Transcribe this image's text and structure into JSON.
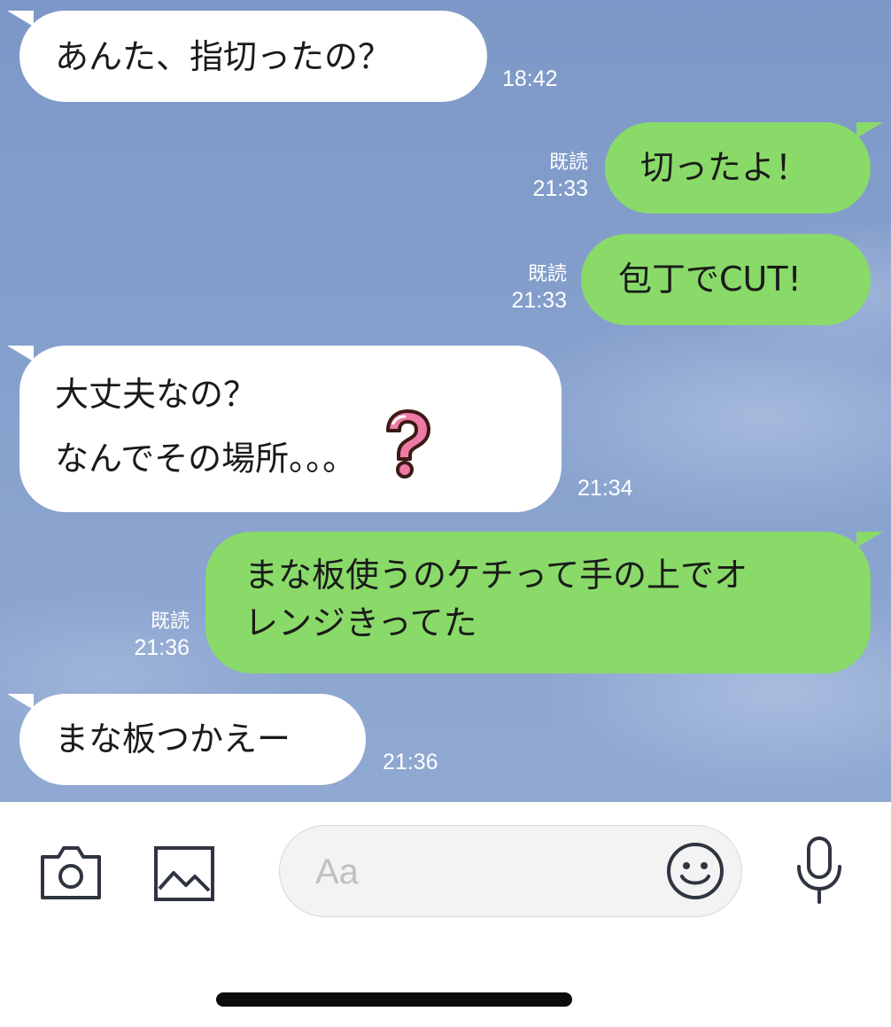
{
  "messages": [
    {
      "side": "in",
      "text": "あんた、指切ったの？",
      "time": "18:42"
    },
    {
      "side": "out",
      "text": "切ったよ！",
      "read": "既読",
      "time": "21:33"
    },
    {
      "side": "out",
      "text": "包丁でCUT!",
      "read": "既読",
      "time": "21:33"
    },
    {
      "side": "in",
      "line1": "大丈夫なの？",
      "line2": "なんでその場所。。。",
      "icon": "question-mark-emoji",
      "time": "21:34"
    },
    {
      "side": "out",
      "line1": "まな板使うのケチって手の上でオ",
      "line2": "レンジきってた",
      "read": "既読",
      "time": "21:36"
    },
    {
      "side": "in",
      "text": "まな板つかえー",
      "time": "21:36"
    }
  ],
  "input": {
    "placeholder": "Aa",
    "icons": [
      "camera-icon",
      "image-icon",
      "smiley-icon",
      "microphone-icon"
    ]
  },
  "colors": {
    "chat_background": "#86a0cd",
    "incoming_bubble": "#ffffff",
    "outgoing_bubble": "#89da68",
    "question_mark": "#ee7aa6"
  }
}
